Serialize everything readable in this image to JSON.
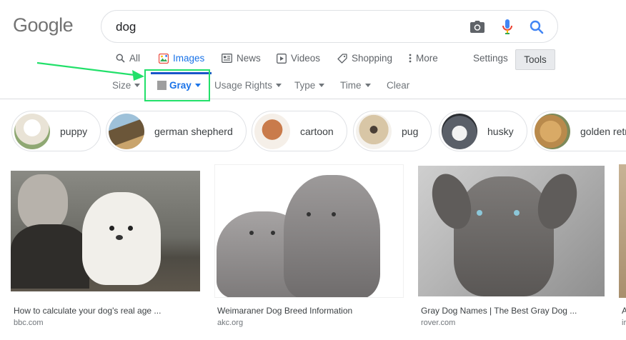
{
  "logo": "Google",
  "search": {
    "query": "dog"
  },
  "nav": {
    "tabs": [
      {
        "label": "All",
        "icon": "search-icon"
      },
      {
        "label": "Images",
        "icon": "images-icon",
        "active": true
      },
      {
        "label": "News",
        "icon": "news-icon"
      },
      {
        "label": "Videos",
        "icon": "video-icon"
      },
      {
        "label": "Shopping",
        "icon": "tag-icon"
      },
      {
        "label": "More",
        "icon": "more-vertical-icon"
      }
    ],
    "settings": "Settings",
    "tools": "Tools"
  },
  "filters": {
    "size": "Size",
    "color": "Gray",
    "usage_rights": "Usage Rights",
    "type": "Type",
    "time": "Time",
    "clear": "Clear"
  },
  "chips": [
    {
      "label": "puppy",
      "color": "#e9e3d6"
    },
    {
      "label": "german shepherd",
      "color": "#6b5639"
    },
    {
      "label": "cartoon",
      "color": "#c97b4b"
    },
    {
      "label": "pug",
      "color": "#d8c6a6"
    },
    {
      "label": "husky",
      "color": "#5a5f68"
    },
    {
      "label": "golden retr",
      "color": "#b98a4c"
    }
  ],
  "results": [
    {
      "title": "How to calculate your dog's real age ...",
      "source": "bbc.com"
    },
    {
      "title": "Weimaraner Dog Breed Information",
      "source": "akc.org"
    },
    {
      "title": "Gray Dog Names | The Best Gray Dog ...",
      "source": "rover.com"
    },
    {
      "title": "A",
      "source": "ir"
    }
  ],
  "colors": {
    "accent": "#1a73e8",
    "annotation_green": "#22e06a",
    "annotation_bar": "#1a56c9"
  }
}
